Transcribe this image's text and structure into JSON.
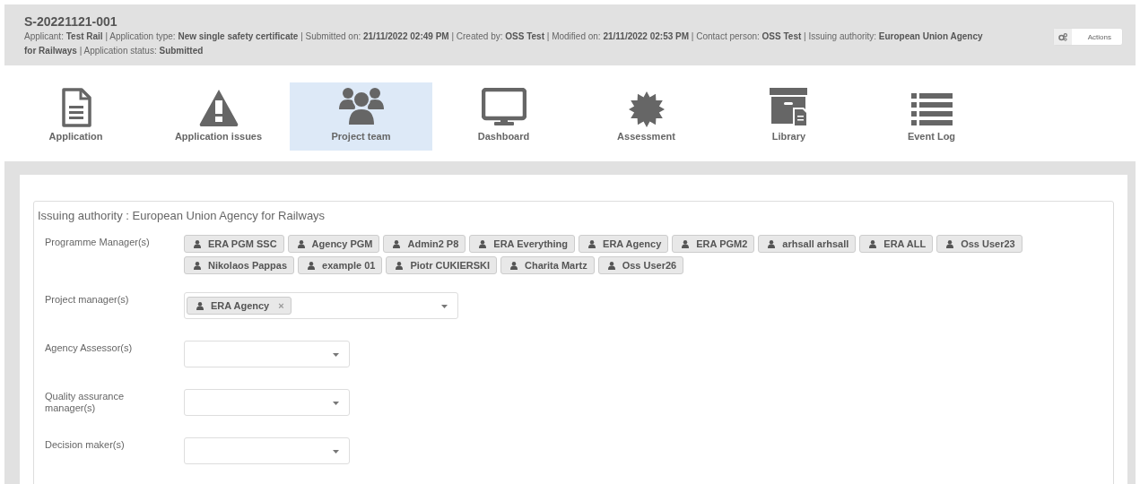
{
  "header": {
    "reference": "S-20221121-001",
    "details": "Applicant: **Test Rail** | Application type: **New single safety certificate** | Submitted on: **21/11/2022 02:49 PM** | Created by: **OSS Test** | Modified on: **21/11/2022 02:53 PM** | Contact person: **OSS Test** | Issuing authority: **European Union Agency for Railways** | Application status: **Submitted**",
    "actions_button": "Actions"
  },
  "nav": [
    {
      "label": "Application",
      "kind": "document",
      "selected": false
    },
    {
      "label": "Application issues",
      "kind": "warning",
      "selected": false
    },
    {
      "label": "Project team",
      "kind": "team",
      "selected": true
    },
    {
      "label": "Dashboard",
      "kind": "monitor",
      "selected": false
    },
    {
      "label": "Assessment",
      "kind": "badge",
      "selected": false
    },
    {
      "label": "Library",
      "kind": "archive",
      "selected": false
    },
    {
      "label": "Event Log",
      "kind": "list",
      "selected": false
    }
  ],
  "panel": {
    "title": "Issuing authority : European Union Agency for Railways",
    "fields": [
      {
        "label": "Programme Manager(s)",
        "kind": "tags",
        "values": [
          "ERA PGM SSC",
          "Agency PGM",
          "Admin2 P8",
          "ERA Everything",
          "ERA Agency",
          "ERA PGM2",
          "arhsall arhsall",
          "ERA ALL",
          "Oss User23",
          "Nikolaos Pappas",
          "example 01",
          "Piotr CUKIERSKI",
          "Charita Martz",
          "Oss User26"
        ]
      },
      {
        "label": "Project manager(s)",
        "kind": "tag_select",
        "values": [
          "ERA Agency"
        ],
        "remove": "×"
      },
      {
        "label": "Agency Assessor(s)",
        "kind": "select"
      },
      {
        "label": "Quality assurance manager(s)",
        "kind": "select"
      },
      {
        "label": "Decision maker(s)",
        "kind": "select"
      }
    ]
  }
}
